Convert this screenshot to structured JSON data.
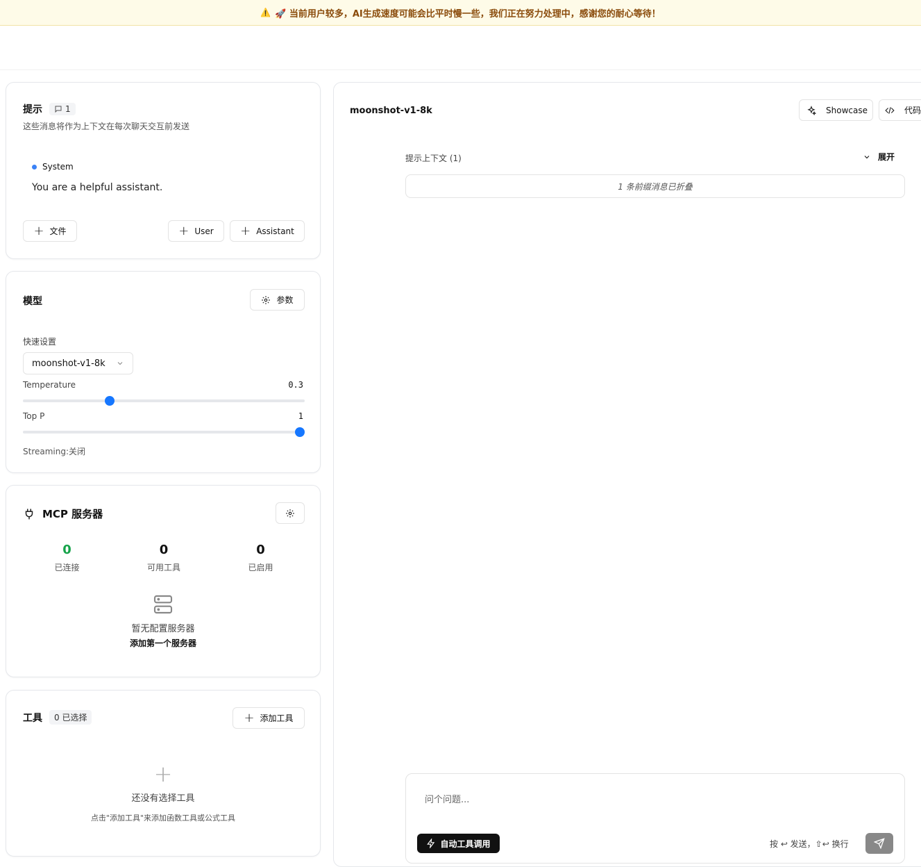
{
  "banner": {
    "text": "🚀 当前用户较多，AI生成速度可能会比平时慢一些，我们正在努力处理中，感谢您的耐心等待！"
  },
  "prompt_card": {
    "title": "提示",
    "badge_count": "1",
    "description": "这些消息将作为上下文在每次聊天交互前发送",
    "message_role": "System",
    "message_text": "You are a helpful assistant.",
    "btn_file": "文件",
    "btn_user": "User",
    "btn_assistant": "Assistant"
  },
  "model_card": {
    "title": "模型",
    "params_btn": "参数",
    "quick_settings_label": "快速设置",
    "selected_model": "moonshot-v1-8k",
    "temperature_label": "Temperature",
    "temperature_value": "0.3",
    "temperature_fraction": 0.3,
    "top_p_label": "Top P",
    "top_p_value": "1",
    "top_p_fraction": 1,
    "streaming_text": "Streaming:关闭"
  },
  "mcp_card": {
    "title": "MCP 服务器",
    "stats": [
      {
        "value": "0",
        "label": "已连接",
        "color": "#16a34a"
      },
      {
        "value": "0",
        "label": "可用工具",
        "color": "#111111"
      },
      {
        "value": "0",
        "label": "已启用",
        "color": "#111111"
      }
    ],
    "empty_title": "暂无配置服务器",
    "empty_action": "添加第一个服务器"
  },
  "tools_card": {
    "title": "工具",
    "selected_badge": "0 已选择",
    "add_btn": "添加工具",
    "empty_title": "还没有选择工具",
    "empty_desc": "点击\"添加工具\"来添加函数工具或公式工具"
  },
  "chat": {
    "model_name": "moonshot-v1-8k",
    "showcase_btn": "Showcase",
    "code_btn": "代码",
    "context_label": "提示上下文 (1)",
    "expand_label": "展开",
    "collapsed_text": "1 条前缀消息已折叠",
    "input_placeholder": "问个问题...",
    "auto_tool_btn": "自动工具调用",
    "send_hint": "按 ↩ 发送，⇧↩ 换行"
  },
  "colors": {
    "accent": "#1677ff",
    "banner_bg": "#fefbe8",
    "banner_text": "#8a4b0b",
    "success": "#16a34a"
  }
}
